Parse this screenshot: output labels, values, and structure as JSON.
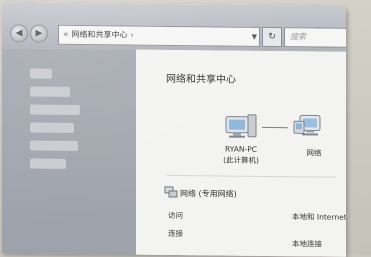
{
  "window": {
    "address": {
      "back_icon": "back-arrow-icon",
      "chevron": "«",
      "crumb": "网络和共享中心",
      "separator": "›"
    },
    "refresh_symbol": "↻",
    "search_placeholder": "搜索"
  },
  "content": {
    "heading": "网络和共享中心",
    "this_pc": {
      "name": "RYAN-PC",
      "subtitle": "(此计算机)"
    },
    "network_node": {
      "name": "网络"
    },
    "network_section": {
      "title": "网络 (专用网络)",
      "access_label": "访问",
      "access_value": "本地和 Internet",
      "connect_label": "连接",
      "connect_value": "本地连接"
    }
  },
  "colors": {
    "titlebar": "#b7bbc2",
    "sidebar": "#a0a4ac",
    "content_bg": "#f3f3f1"
  }
}
